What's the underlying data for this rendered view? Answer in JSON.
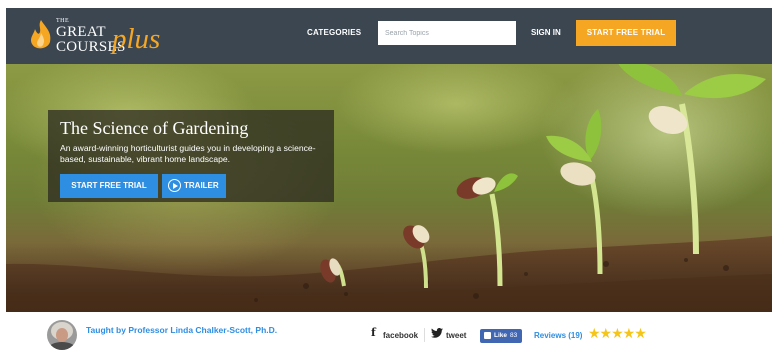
{
  "header": {
    "logo": {
      "the": "THE",
      "great": "GREAT",
      "courses": "COURSES",
      "plus": "plus"
    },
    "categories_label": "CATEGORIES",
    "search_placeholder": "Search Topics",
    "sign_in_label": "SIGN IN",
    "trial_label": "START FREE TRIAL"
  },
  "hero": {
    "title": "The Science of Gardening",
    "description": "An award-winning horticulturist guides you in developing a science-based, sustainable, vibrant home landscape.",
    "trial_label": "START FREE TRIAL",
    "trailer_label": "TRAILER"
  },
  "course_info": {
    "instructor": "Taught by Professor Linda Chalker-Scott, Ph.D.",
    "facebook_label": "facebook",
    "tweet_label": "tweet",
    "like_label": "Like",
    "like_count": "83",
    "reviews_label": "Reviews (19)",
    "rating": 5,
    "stars": "★★★★★"
  },
  "colors": {
    "header_bg": "#3b4651",
    "accent_orange": "#f5a623",
    "accent_blue": "#2e8ee2",
    "star_yellow": "#f5c518",
    "facebook_blue": "#4267b2"
  },
  "icons": [
    "flame-logo-icon",
    "play-circle-icon",
    "facebook-icon",
    "twitter-icon",
    "thumbs-up-icon",
    "star-icon"
  ]
}
